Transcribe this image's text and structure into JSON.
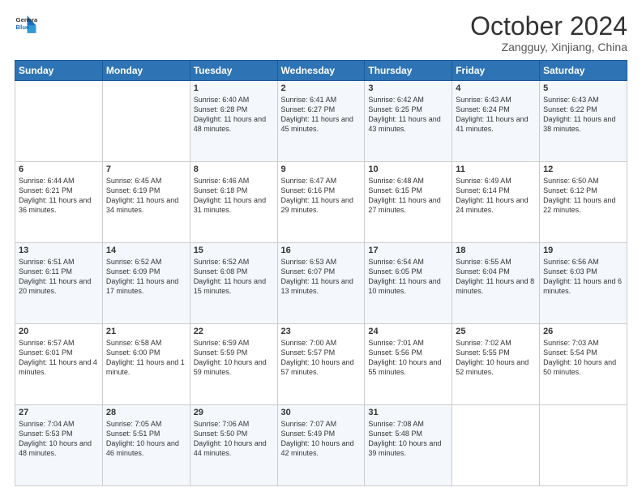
{
  "logo": {
    "line1": "General",
    "line2": "Blue"
  },
  "header": {
    "month": "October 2024",
    "location": "Zangguy, Xinjiang, China"
  },
  "weekdays": [
    "Sunday",
    "Monday",
    "Tuesday",
    "Wednesday",
    "Thursday",
    "Friday",
    "Saturday"
  ],
  "weeks": [
    [
      {
        "day": "",
        "content": ""
      },
      {
        "day": "",
        "content": ""
      },
      {
        "day": "1",
        "content": "Sunrise: 6:40 AM\nSunset: 6:28 PM\nDaylight: 11 hours and 48 minutes."
      },
      {
        "day": "2",
        "content": "Sunrise: 6:41 AM\nSunset: 6:27 PM\nDaylight: 11 hours and 45 minutes."
      },
      {
        "day": "3",
        "content": "Sunrise: 6:42 AM\nSunset: 6:25 PM\nDaylight: 11 hours and 43 minutes."
      },
      {
        "day": "4",
        "content": "Sunrise: 6:43 AM\nSunset: 6:24 PM\nDaylight: 11 hours and 41 minutes."
      },
      {
        "day": "5",
        "content": "Sunrise: 6:43 AM\nSunset: 6:22 PM\nDaylight: 11 hours and 38 minutes."
      }
    ],
    [
      {
        "day": "6",
        "content": "Sunrise: 6:44 AM\nSunset: 6:21 PM\nDaylight: 11 hours and 36 minutes."
      },
      {
        "day": "7",
        "content": "Sunrise: 6:45 AM\nSunset: 6:19 PM\nDaylight: 11 hours and 34 minutes."
      },
      {
        "day": "8",
        "content": "Sunrise: 6:46 AM\nSunset: 6:18 PM\nDaylight: 11 hours and 31 minutes."
      },
      {
        "day": "9",
        "content": "Sunrise: 6:47 AM\nSunset: 6:16 PM\nDaylight: 11 hours and 29 minutes."
      },
      {
        "day": "10",
        "content": "Sunrise: 6:48 AM\nSunset: 6:15 PM\nDaylight: 11 hours and 27 minutes."
      },
      {
        "day": "11",
        "content": "Sunrise: 6:49 AM\nSunset: 6:14 PM\nDaylight: 11 hours and 24 minutes."
      },
      {
        "day": "12",
        "content": "Sunrise: 6:50 AM\nSunset: 6:12 PM\nDaylight: 11 hours and 22 minutes."
      }
    ],
    [
      {
        "day": "13",
        "content": "Sunrise: 6:51 AM\nSunset: 6:11 PM\nDaylight: 11 hours and 20 minutes."
      },
      {
        "day": "14",
        "content": "Sunrise: 6:52 AM\nSunset: 6:09 PM\nDaylight: 11 hours and 17 minutes."
      },
      {
        "day": "15",
        "content": "Sunrise: 6:52 AM\nSunset: 6:08 PM\nDaylight: 11 hours and 15 minutes."
      },
      {
        "day": "16",
        "content": "Sunrise: 6:53 AM\nSunset: 6:07 PM\nDaylight: 11 hours and 13 minutes."
      },
      {
        "day": "17",
        "content": "Sunrise: 6:54 AM\nSunset: 6:05 PM\nDaylight: 11 hours and 10 minutes."
      },
      {
        "day": "18",
        "content": "Sunrise: 6:55 AM\nSunset: 6:04 PM\nDaylight: 11 hours and 8 minutes."
      },
      {
        "day": "19",
        "content": "Sunrise: 6:56 AM\nSunset: 6:03 PM\nDaylight: 11 hours and 6 minutes."
      }
    ],
    [
      {
        "day": "20",
        "content": "Sunrise: 6:57 AM\nSunset: 6:01 PM\nDaylight: 11 hours and 4 minutes."
      },
      {
        "day": "21",
        "content": "Sunrise: 6:58 AM\nSunset: 6:00 PM\nDaylight: 11 hours and 1 minute."
      },
      {
        "day": "22",
        "content": "Sunrise: 6:59 AM\nSunset: 5:59 PM\nDaylight: 10 hours and 59 minutes."
      },
      {
        "day": "23",
        "content": "Sunrise: 7:00 AM\nSunset: 5:57 PM\nDaylight: 10 hours and 57 minutes."
      },
      {
        "day": "24",
        "content": "Sunrise: 7:01 AM\nSunset: 5:56 PM\nDaylight: 10 hours and 55 minutes."
      },
      {
        "day": "25",
        "content": "Sunrise: 7:02 AM\nSunset: 5:55 PM\nDaylight: 10 hours and 52 minutes."
      },
      {
        "day": "26",
        "content": "Sunrise: 7:03 AM\nSunset: 5:54 PM\nDaylight: 10 hours and 50 minutes."
      }
    ],
    [
      {
        "day": "27",
        "content": "Sunrise: 7:04 AM\nSunset: 5:53 PM\nDaylight: 10 hours and 48 minutes."
      },
      {
        "day": "28",
        "content": "Sunrise: 7:05 AM\nSunset: 5:51 PM\nDaylight: 10 hours and 46 minutes."
      },
      {
        "day": "29",
        "content": "Sunrise: 7:06 AM\nSunset: 5:50 PM\nDaylight: 10 hours and 44 minutes."
      },
      {
        "day": "30",
        "content": "Sunrise: 7:07 AM\nSunset: 5:49 PM\nDaylight: 10 hours and 42 minutes."
      },
      {
        "day": "31",
        "content": "Sunrise: 7:08 AM\nSunset: 5:48 PM\nDaylight: 10 hours and 39 minutes."
      },
      {
        "day": "",
        "content": ""
      },
      {
        "day": "",
        "content": ""
      }
    ]
  ]
}
